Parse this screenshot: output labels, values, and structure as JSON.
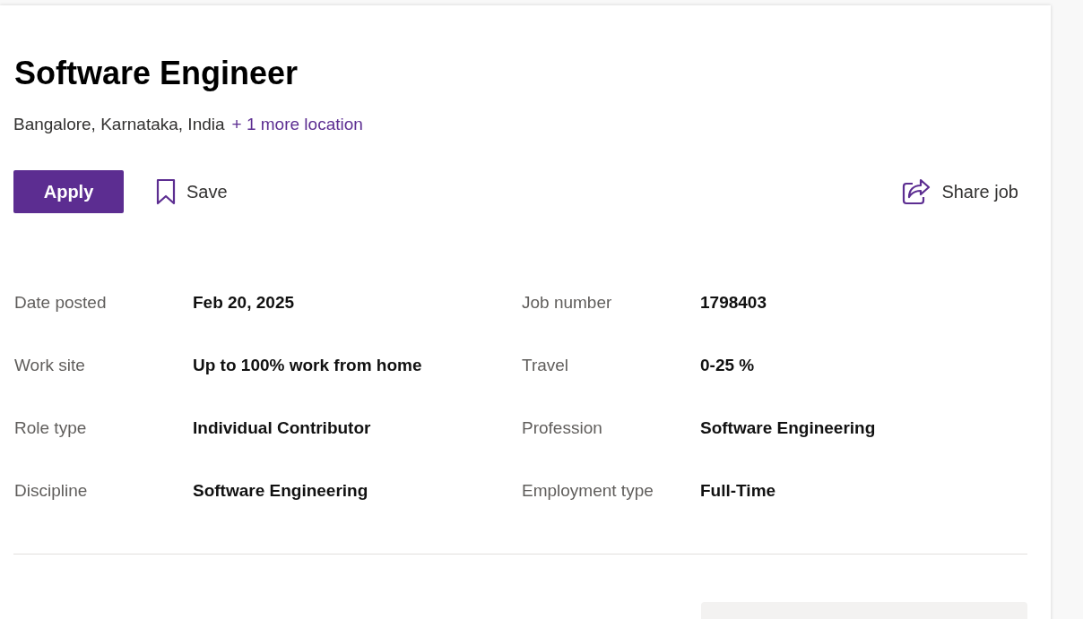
{
  "job": {
    "title": "Software Engineer",
    "location": "Bangalore, Karnataka, India",
    "more_locations": "+ 1 more location"
  },
  "actions": [
    {
      "kind": "apply",
      "label": "Apply"
    },
    {
      "kind": "save",
      "label": "Save"
    },
    {
      "kind": "share",
      "label": "Share job"
    }
  ],
  "details": [
    {
      "label": "Date posted",
      "value": "Feb 20, 2025"
    },
    {
      "label": "Job number",
      "value": "1798403"
    },
    {
      "label": "Work site",
      "value": "Up to 100% work from home"
    },
    {
      "label": "Travel",
      "value": "0-25 %"
    },
    {
      "label": "Role type",
      "value": "Individual Contributor"
    },
    {
      "label": "Profession",
      "value": "Software Engineering"
    },
    {
      "label": "Discipline",
      "value": "Software Engineering"
    },
    {
      "label": "Employment type",
      "value": "Full-Time"
    }
  ]
}
